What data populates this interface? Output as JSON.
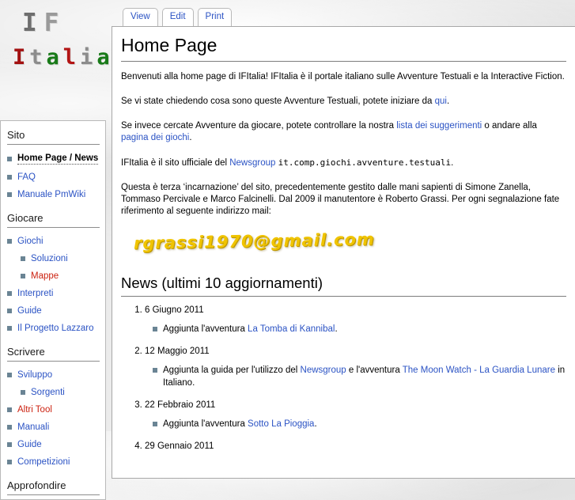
{
  "colors": {
    "link_blue": "#2b53c4",
    "link_red": "#cc2211",
    "bullet": "#6a8494",
    "email_yellow": "#f0c400"
  },
  "logo": {
    "line1": [
      {
        "ch": "I",
        "color": "#6e6e6e"
      },
      {
        "ch": "F",
        "color": "#9a9a9a"
      }
    ],
    "line2": [
      {
        "ch": "I",
        "color": "#a31111"
      },
      {
        "ch": "t",
        "color": "#8c8c8c"
      },
      {
        "ch": "a",
        "color": "#187a18"
      },
      {
        "ch": "l",
        "color": "#b31414"
      },
      {
        "ch": "i",
        "color": "#8c8c8c"
      },
      {
        "ch": "a",
        "color": "#187a18"
      }
    ]
  },
  "tabs": [
    {
      "label": "View"
    },
    {
      "label": "Edit"
    },
    {
      "label": "Print"
    }
  ],
  "sidebar": {
    "sections": [
      {
        "title": "Sito",
        "items": [
          {
            "label": "Home Page / News",
            "type": "current",
            "indent": 0
          },
          {
            "label": "FAQ",
            "type": "link",
            "indent": 0
          },
          {
            "label": "Manuale PmWiki",
            "type": "link",
            "indent": 0
          }
        ]
      },
      {
        "title": "Giocare",
        "items": [
          {
            "label": "Giochi",
            "type": "link",
            "indent": 0
          },
          {
            "label": "Soluzioni",
            "type": "link",
            "indent": 1
          },
          {
            "label": "Mappe",
            "type": "missing",
            "indent": 1
          },
          {
            "label": "Interpreti",
            "type": "link",
            "indent": 0
          },
          {
            "label": "Guide",
            "type": "link",
            "indent": 0
          },
          {
            "label": "Il Progetto Lazzaro",
            "type": "link",
            "indent": 0
          }
        ]
      },
      {
        "title": "Scrivere",
        "items": [
          {
            "label": "Sviluppo",
            "type": "link",
            "indent": 0
          },
          {
            "label": "Sorgenti",
            "type": "link",
            "indent": 1
          },
          {
            "label": "Altri Tool",
            "type": "missing",
            "indent": 0
          },
          {
            "label": "Manuali",
            "type": "link",
            "indent": 0
          },
          {
            "label": "Guide",
            "type": "link",
            "indent": 0
          },
          {
            "label": "Competizioni",
            "type": "link",
            "indent": 0
          }
        ]
      },
      {
        "title": "Approfondire",
        "items": []
      }
    ]
  },
  "main": {
    "title": "Home Page",
    "paragraphs": [
      {
        "segments": [
          {
            "k": "plain",
            "t": "Benvenuti alla home page di IFItalia! IFItalia è il portale italiano sulle Avventure Testuali e la Interactive Fiction."
          }
        ]
      },
      {
        "segments": [
          {
            "k": "plain",
            "t": "Se vi state chiedendo cosa sono queste Avventure Testuali, potete iniziare da "
          },
          {
            "k": "link",
            "t": "qui"
          },
          {
            "k": "plain",
            "t": "."
          }
        ]
      },
      {
        "segments": [
          {
            "k": "plain",
            "t": "Se invece cercate Avventure da giocare, potete controllare la nostra "
          },
          {
            "k": "link",
            "t": "lista dei suggerimenti"
          },
          {
            "k": "plain",
            "t": " o andare alla "
          },
          {
            "k": "link",
            "t": "pagina dei giochi"
          },
          {
            "k": "plain",
            "t": "."
          }
        ]
      },
      {
        "segments": [
          {
            "k": "plain",
            "t": "IFItalia è il sito ufficiale del "
          },
          {
            "k": "link",
            "t": "Newsgroup"
          },
          {
            "k": "plain",
            "t": " "
          },
          {
            "k": "mono",
            "t": "it.comp.giochi.avventure.testuali"
          },
          {
            "k": "plain",
            "t": "."
          }
        ]
      },
      {
        "segments": [
          {
            "k": "plain",
            "t": "Questa è terza ‘incarnazione’ del sito, precedentemente gestito dalle mani sapienti di Simone Zanella, Tommaso Percivale e Marco Falcinelli. Dal 2009 il manutentore è Roberto Grassi. Per ogni segnalazione fate riferimento al seguente indirizzo mail:"
          }
        ]
      }
    ],
    "email_text": "rgrassi1970@gmail.com",
    "news": {
      "title": "News (ultimi 10 aggiornamenti)",
      "items": [
        {
          "date": "6 Giugno 2011",
          "entries": [
            {
              "segments": [
                {
                  "k": "plain",
                  "t": "Aggiunta l'avventura "
                },
                {
                  "k": "link",
                  "t": "La Tomba di Kannibal"
                },
                {
                  "k": "plain",
                  "t": "."
                }
              ]
            }
          ]
        },
        {
          "date": "12 Maggio 2011",
          "entries": [
            {
              "segments": [
                {
                  "k": "plain",
                  "t": "Aggiunta la guida per l'utilizzo del "
                },
                {
                  "k": "link",
                  "t": "Newsgroup"
                },
                {
                  "k": "plain",
                  "t": " e l'avventura "
                },
                {
                  "k": "link",
                  "t": "The Moon Watch - La Guardia Lunare"
                },
                {
                  "k": "plain",
                  "t": " in Italiano."
                }
              ]
            }
          ]
        },
        {
          "date": "22 Febbraio 2011",
          "entries": [
            {
              "segments": [
                {
                  "k": "plain",
                  "t": "Aggiunta l'avventura "
                },
                {
                  "k": "link",
                  "t": "Sotto La Pioggia"
                },
                {
                  "k": "plain",
                  "t": "."
                }
              ]
            }
          ]
        },
        {
          "date": "29 Gennaio 2011",
          "entries": []
        }
      ]
    }
  }
}
